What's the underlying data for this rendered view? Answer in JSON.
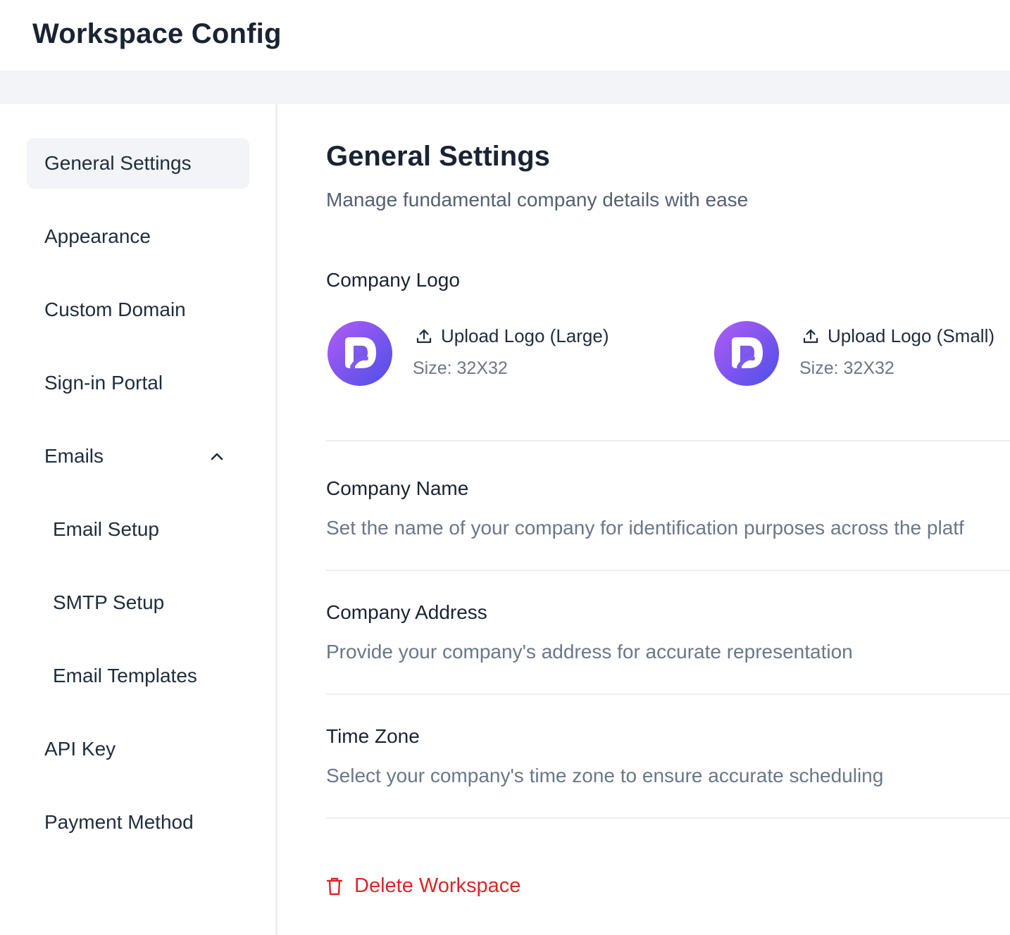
{
  "app": {
    "title": "Workspace Config"
  },
  "sidebar": {
    "items": [
      {
        "label": "General Settings",
        "active": true
      },
      {
        "label": "Appearance"
      },
      {
        "label": "Custom Domain"
      },
      {
        "label": "Sign-in Portal"
      },
      {
        "label": "Emails",
        "expanded": true,
        "icon": "chevron-up-icon"
      },
      {
        "label": "Email Setup"
      },
      {
        "label": "SMTP Setup"
      },
      {
        "label": "Email Templates"
      },
      {
        "label": "API Key"
      },
      {
        "label": "Payment Method"
      }
    ]
  },
  "main": {
    "title": "General Settings",
    "subtitle": "Manage fundamental company details with ease",
    "logo_section": {
      "title": "Company Logo",
      "large": {
        "button": "Upload Logo (Large)",
        "size": "Size: 32X32",
        "icon": "upload-icon"
      },
      "small": {
        "button": "Upload Logo (Small)",
        "size": "Size: 32X32",
        "icon": "upload-icon"
      }
    },
    "company_name": {
      "title": "Company Name",
      "description": "Set the name of your company for identification purposes across the platf"
    },
    "company_address": {
      "title": "Company Address",
      "description": "Provide your company's address for accurate representation"
    },
    "time_zone": {
      "title": "Time Zone",
      "description": "Select your company's time zone to ensure accurate scheduling"
    },
    "delete": {
      "label": "Delete Workspace",
      "icon": "trash-icon"
    }
  },
  "colors": {
    "accent_gradient_start": "#a855f7",
    "accent_gradient_end": "#4f46e5",
    "danger": "#dc2626",
    "active_bg": "#f2f4f7"
  }
}
